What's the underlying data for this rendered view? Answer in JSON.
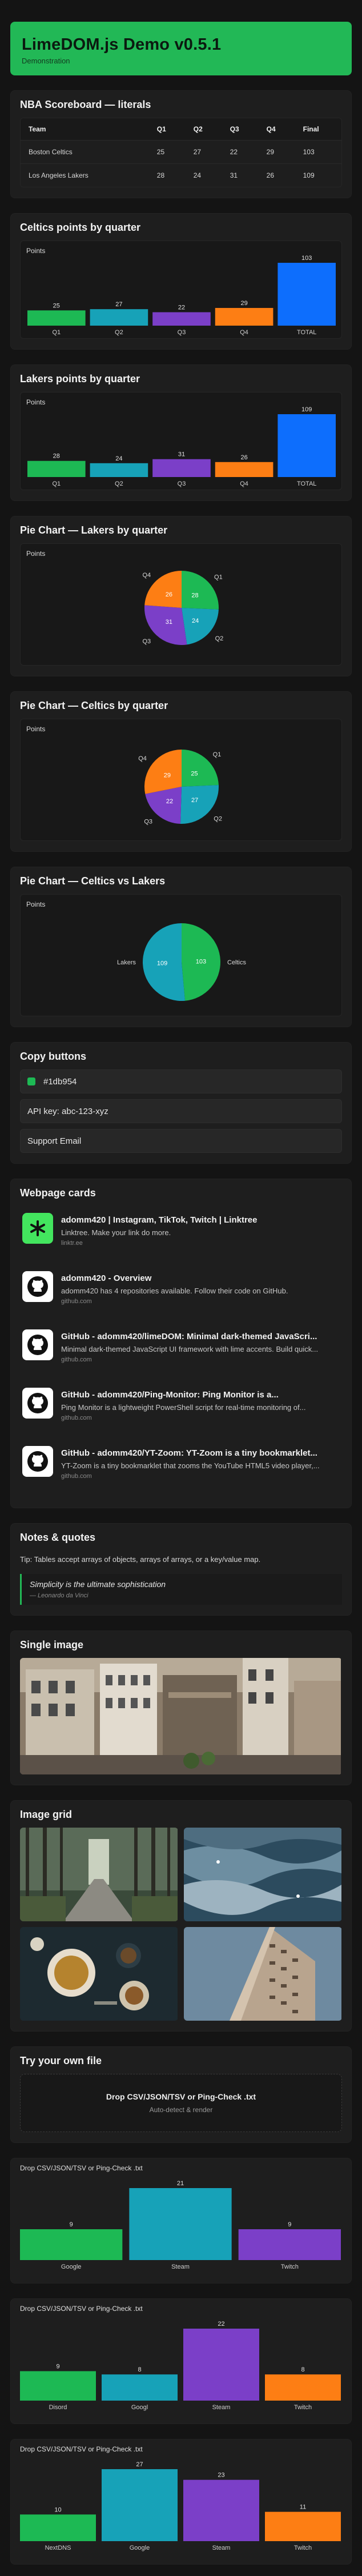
{
  "hero": {
    "title": "LimeDOM.js Demo v0.5.1",
    "subtitle": "Demonstration"
  },
  "scoreboard": {
    "title": "NBA Scoreboard — literals",
    "headers": [
      "Team",
      "Q1",
      "Q2",
      "Q3",
      "Q4",
      "Final"
    ],
    "rows": [
      [
        "Boston Celtics",
        "25",
        "27",
        "22",
        "29",
        "103"
      ],
      [
        "Los Angeles Lakers",
        "28",
        "24",
        "31",
        "26",
        "109"
      ]
    ]
  },
  "colors": {
    "green": "#1db954",
    "teal": "#17a2b8",
    "purple": "#7b3fc8",
    "orange": "#fd7e14",
    "blue": "#0d6efd"
  },
  "chart_data": [
    {
      "type": "bar",
      "title": "Celtics points by quarter",
      "ylabel": "Points",
      "categories": [
        "Q1",
        "Q2",
        "Q3",
        "Q4",
        "TOTAL"
      ],
      "values": [
        25,
        27,
        22,
        29,
        103
      ]
    },
    {
      "type": "bar",
      "title": "Lakers points by quarter",
      "ylabel": "Points",
      "categories": [
        "Q1",
        "Q2",
        "Q3",
        "Q4",
        "TOTAL"
      ],
      "values": [
        28,
        24,
        31,
        26,
        109
      ]
    },
    {
      "type": "pie",
      "title": "Pie Chart — Lakers by quarter",
      "ylabel": "Points",
      "categories": [
        "Q1",
        "Q2",
        "Q3",
        "Q4"
      ],
      "values": [
        28,
        24,
        31,
        26
      ]
    },
    {
      "type": "pie",
      "title": "Pie Chart — Celtics by quarter",
      "ylabel": "Points",
      "categories": [
        "Q1",
        "Q2",
        "Q3",
        "Q4"
      ],
      "values": [
        25,
        27,
        22,
        29
      ]
    },
    {
      "type": "pie",
      "title": "Pie Chart — Celtics vs Lakers",
      "ylabel": "Points",
      "categories": [
        "Celtics",
        "Lakers"
      ],
      "values": [
        103,
        109
      ]
    },
    {
      "type": "bar",
      "title": "Drop CSV/JSON/TSV or Ping-Check .txt",
      "categories": [
        "Google",
        "Steam",
        "Twitch"
      ],
      "values": [
        9,
        21,
        9
      ]
    },
    {
      "type": "bar",
      "title": "Drop CSV/JSON/TSV or Ping-Check .txt",
      "categories": [
        "Disord",
        "Googl",
        "Steam",
        "Twitch"
      ],
      "values": [
        9,
        8,
        22,
        8
      ]
    },
    {
      "type": "bar",
      "title": "Drop CSV/JSON/TSV or Ping-Check .txt",
      "categories": [
        "NextDNS",
        "Google",
        "Steam",
        "Twitch"
      ],
      "values": [
        10,
        27,
        23,
        11
      ]
    }
  ],
  "copy": {
    "title": "Copy buttons",
    "items": [
      "#1db954",
      "API key: abc-123-xyz",
      "Support Email"
    ]
  },
  "webcards": {
    "title": "Webpage cards",
    "items": [
      {
        "title": "adomm420 | Instagram, TikTok, Twitch | Linktree",
        "desc": "Linktree. Make your link do more.",
        "host": "linktr.ee",
        "icon": "linktree-icon"
      },
      {
        "title": "adomm420 - Overview",
        "desc": "adomm420 has 4 repositories available. Follow their code on GitHub.",
        "host": "github.com",
        "icon": "github-icon"
      },
      {
        "title": "GitHub - adomm420/limeDOM: Minimal dark-themed JavaScri...",
        "desc": "Minimal dark-themed JavaScript UI framework with lime accents. Build quick...",
        "host": "github.com",
        "icon": "github-icon"
      },
      {
        "title": "GitHub - adomm420/Ping-Monitor: Ping Monitor is a...",
        "desc": "Ping Monitor is a lightweight PowerShell script for real-time monitoring of...",
        "host": "github.com",
        "icon": "github-icon"
      },
      {
        "title": "GitHub - adomm420/YT-Zoom: YT-Zoom is a tiny bookmarklet...",
        "desc": "YT-Zoom is a tiny bookmarklet that zooms the YouTube HTML5 video player,...",
        "host": "github.com",
        "icon": "github-icon"
      }
    ]
  },
  "notes": {
    "title": "Notes & quotes",
    "tip": "Tip: Tables accept arrays of objects, arrays of arrays, or a key/value map.",
    "quote": "Simplicity is the ultimate sophistication",
    "author": "— Leonardo da Vinci"
  },
  "single_image": {
    "title": "Single image"
  },
  "image_grid": {
    "title": "Image grid"
  },
  "tryfile": {
    "title": "Try your own file",
    "drop": "Drop CSV/JSON/TSV or Ping-Check .txt",
    "sub": "Auto-detect & render"
  }
}
